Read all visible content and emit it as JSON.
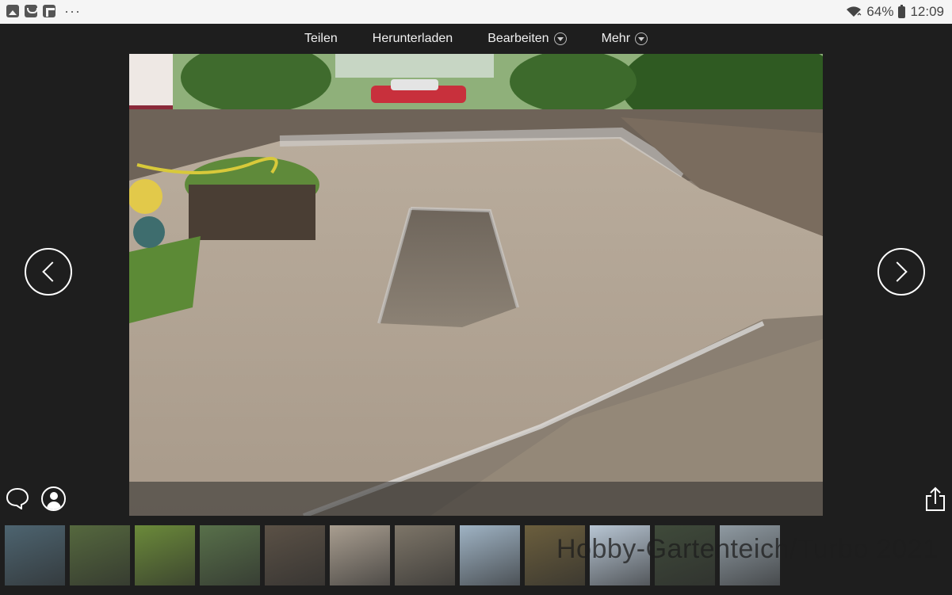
{
  "status_bar": {
    "left_icons": [
      "gallery-icon",
      "mail-icon",
      "flipboard-icon"
    ],
    "more": "···",
    "battery_percent": "64%",
    "time": "12:09"
  },
  "action_bar": {
    "share": "Teilen",
    "download": "Herunterladen",
    "edit": "Bearbeiten",
    "more": "Mehr"
  },
  "watermark": "Hobby-Gartenteich/Turbo 2021",
  "thumbnails": [
    {
      "bg": "#4d6470"
    },
    {
      "bg": "#55683e"
    },
    {
      "bg": "#6b8a3a"
    },
    {
      "bg": "#58704a"
    },
    {
      "bg": "#5b5146"
    },
    {
      "bg": "#a99e90"
    },
    {
      "bg": "#7d7568"
    },
    {
      "bg": "#9fb3c4"
    },
    {
      "bg": "#6b5e3d"
    },
    {
      "bg": "#b8c6d4"
    },
    {
      "bg": "#3f4a3a"
    },
    {
      "bg": "#8f9aa2"
    }
  ]
}
